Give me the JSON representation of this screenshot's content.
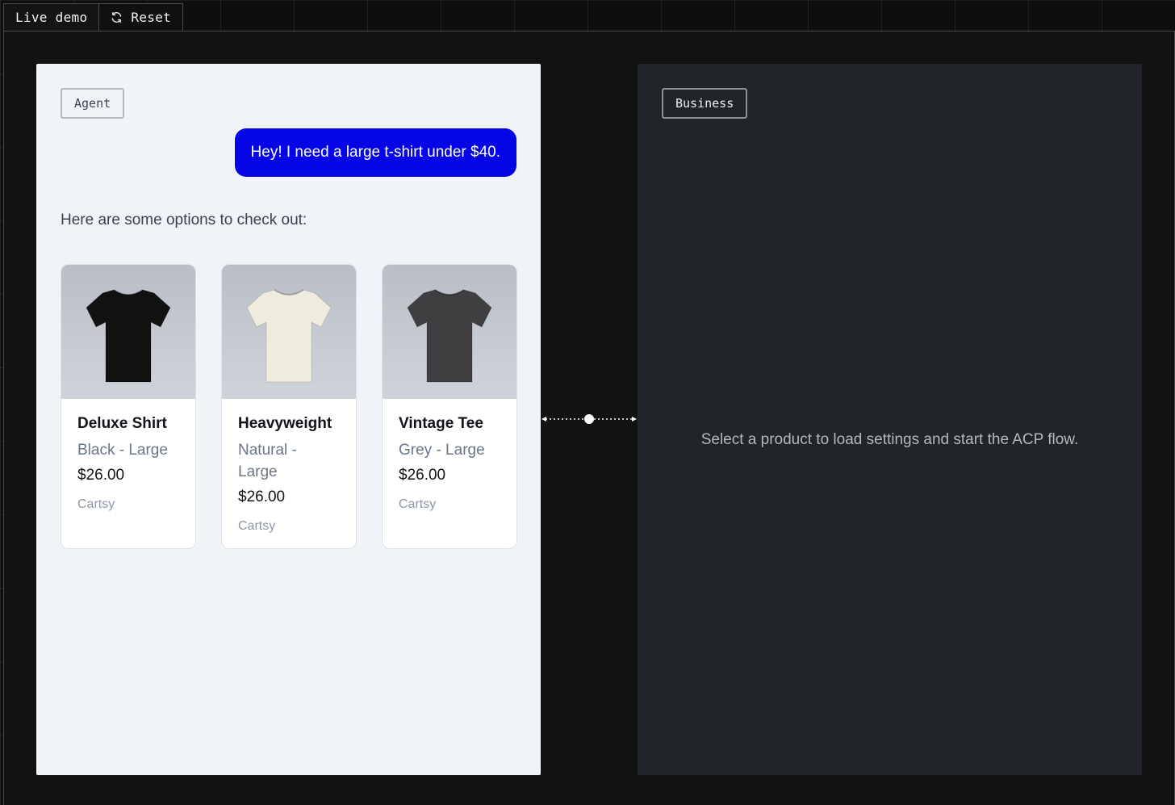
{
  "tabs": {
    "live_demo": "Live demo",
    "reset": "Reset",
    "reset_icon": "refresh-icon"
  },
  "agent": {
    "label": "Agent",
    "user_message": "Hey! I need a large t-shirt under $40.",
    "reply": "Here are some options to check out:",
    "products": [
      {
        "name": "Deluxe Shirt",
        "variant": "Black - Large",
        "price": "$26.00",
        "seller": "Cartsy",
        "color": "#111111"
      },
      {
        "name": "Heavyweight",
        "variant": "Natural - Large",
        "price": "$26.00",
        "seller": "Cartsy",
        "color": "#efebdf"
      },
      {
        "name": "Vintage Tee",
        "variant": "Grey - Large",
        "price": "$26.00",
        "seller": "Cartsy",
        "color": "#3f3f41"
      }
    ]
  },
  "business": {
    "label": "Business",
    "message": "Select a product to load settings and start the ACP flow."
  },
  "colors": {
    "bubble": "#0505e6",
    "agent_bg": "#f0f3f8",
    "business_bg": "#21252a",
    "page_bg": "#0e0e0f"
  }
}
